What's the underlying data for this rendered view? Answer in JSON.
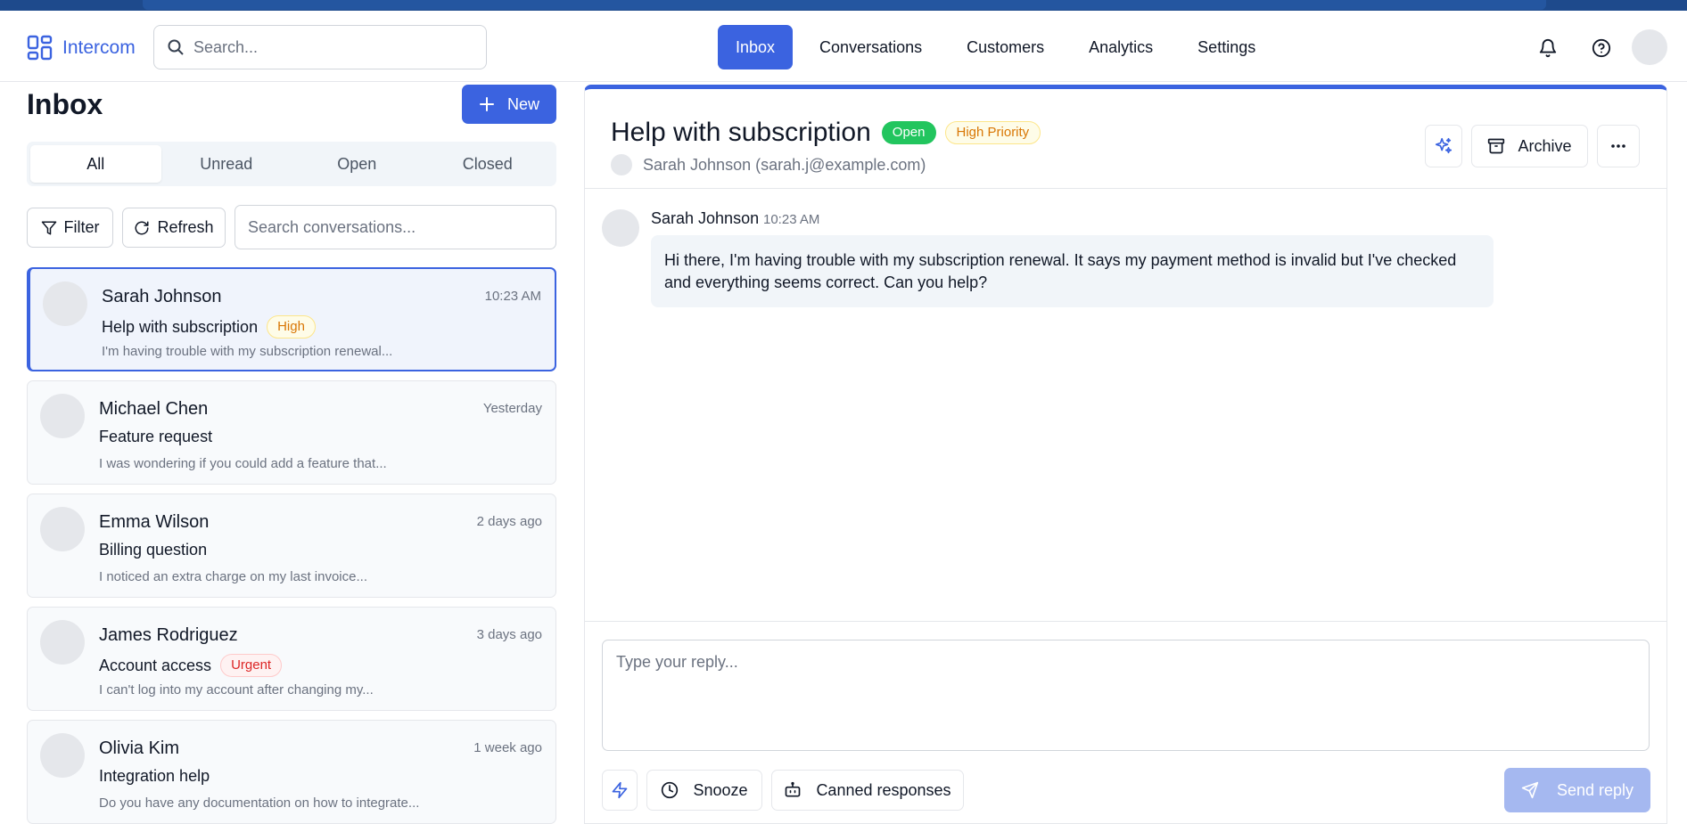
{
  "app": {
    "name": "Intercom"
  },
  "header": {
    "search_placeholder": "Search...",
    "nav": [
      {
        "label": "Inbox",
        "active": true
      },
      {
        "label": "Conversations",
        "active": false
      },
      {
        "label": "Customers",
        "active": false
      },
      {
        "label": "Analytics",
        "active": false
      },
      {
        "label": "Settings",
        "active": false
      }
    ],
    "icons": [
      "bell-icon",
      "help-icon",
      "user-avatar"
    ]
  },
  "inbox": {
    "title": "Inbox",
    "new_label": "New",
    "tabs": [
      {
        "label": "All",
        "active": true
      },
      {
        "label": "Unread",
        "active": false
      },
      {
        "label": "Open",
        "active": false
      },
      {
        "label": "Closed",
        "active": false
      }
    ],
    "filter_label": "Filter",
    "refresh_label": "Refresh",
    "search_placeholder": "Search conversations...",
    "conversations": [
      {
        "name": "Sarah Johnson",
        "time": "10:23 AM",
        "subject": "Help with subscription",
        "badge": "High",
        "preview": "I'm having trouble with my subscription renewal...",
        "active": true
      },
      {
        "name": "Michael Chen",
        "time": "Yesterday",
        "subject": "Feature request",
        "badge": "",
        "preview": "I was wondering if you could add a feature that...",
        "active": false
      },
      {
        "name": "Emma Wilson",
        "time": "2 days ago",
        "subject": "Billing question",
        "badge": "",
        "preview": "I noticed an extra charge on my last invoice...",
        "active": false
      },
      {
        "name": "James Rodriguez",
        "time": "3 days ago",
        "subject": "Account access",
        "badge": "Urgent",
        "preview": "I can't log into my account after changing my...",
        "active": false
      },
      {
        "name": "Olivia Kim",
        "time": "1 week ago",
        "subject": "Integration help",
        "badge": "",
        "preview": "Do you have any documentation on how to integrate...",
        "active": false
      }
    ]
  },
  "conversation": {
    "title": "Help with subscription",
    "status": "Open",
    "priority": "High Priority",
    "requester": "Sarah Johnson (sarah.j@example.com)",
    "archive_label": "Archive",
    "messages": [
      {
        "author": "Sarah Johnson",
        "time": "10:23 AM",
        "text": "Hi there, I'm having trouble with my subscription renewal. It says my payment method is invalid but I've checked and everything seems correct. Can you help?"
      }
    ],
    "reply_placeholder": "Type your reply...",
    "snooze_label": "Snooze",
    "canned_label": "Canned responses",
    "send_label": "Send reply"
  },
  "colors": {
    "accent": "#3b63e0",
    "open_badge": "#22c55e",
    "high_badge_text": "#d97706",
    "urgent_badge_text": "#dc2626",
    "send_disabled": "#a5b8f0"
  }
}
